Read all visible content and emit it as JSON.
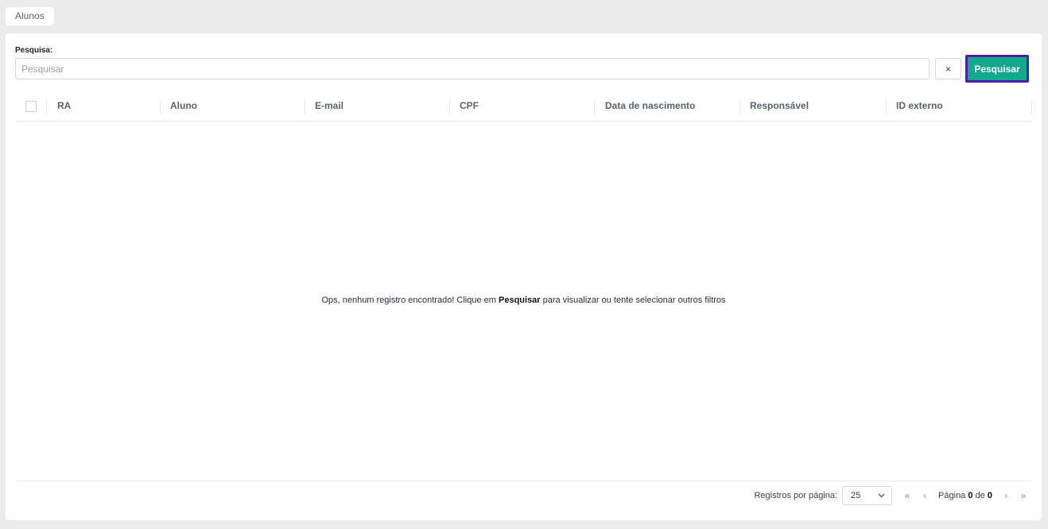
{
  "tabs": [
    {
      "label": "Alunos"
    }
  ],
  "search": {
    "label": "Pesquisa:",
    "placeholder": "Pesquisar",
    "value": "",
    "clear_icon": "×",
    "button_label": "Pesquisar"
  },
  "table": {
    "columns": [
      "RA",
      "Aluno",
      "E-mail",
      "CPF",
      "Data de nascimento",
      "Responsável",
      "ID externo"
    ],
    "rows": []
  },
  "empty_message": {
    "before": "Ops, nenhum registro encontrado! Clique em ",
    "bold": "Pesquisar",
    "after": " para visualizar ou tente selecionar outros filtros"
  },
  "pagination": {
    "per_page_label": "Registros por página:",
    "per_page_value": "25",
    "page_prefix": "Página",
    "current_page": "0",
    "page_of": "de",
    "total_pages": "0",
    "first_icon": "«",
    "prev_icon": "‹",
    "next_icon": "›",
    "last_icon": "»"
  },
  "colors": {
    "accent": "#12a88c",
    "focus_border": "#4b1fa8",
    "background": "#ebebeb"
  }
}
